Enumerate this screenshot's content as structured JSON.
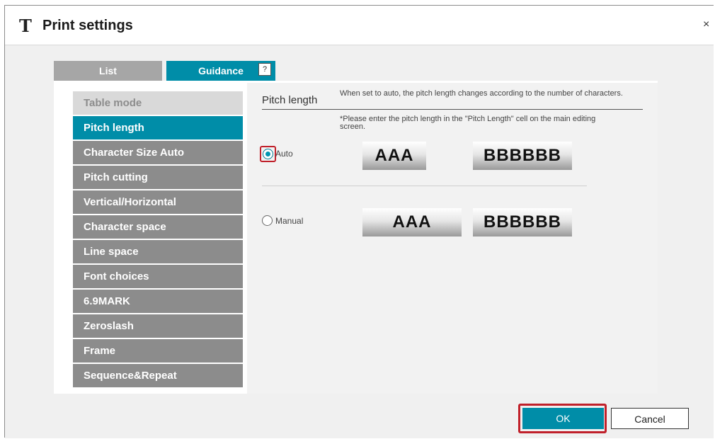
{
  "window": {
    "title": "Print settings",
    "app_icon_glyph": "T",
    "close_glyph": "×"
  },
  "tabs": [
    {
      "label": "List",
      "active": false
    },
    {
      "label": "Guidance",
      "active": true
    }
  ],
  "help_glyph": "?",
  "sidebar": {
    "items": [
      {
        "label": "Table mode"
      },
      {
        "label": "Pitch length"
      },
      {
        "label": "Character Size Auto"
      },
      {
        "label": "Pitch cutting"
      },
      {
        "label": "Vertical/Horizontal"
      },
      {
        "label": "Character space"
      },
      {
        "label": "Line space"
      },
      {
        "label": "Font choices"
      },
      {
        "label": "6.9MARK"
      },
      {
        "label": "Zeroslash"
      },
      {
        "label": "Frame"
      },
      {
        "label": "Sequence&Repeat"
      }
    ],
    "active_index": 1
  },
  "content": {
    "title": "Pitch length",
    "description": "When set to auto, the pitch length changes according to the number of characters.",
    "note": "*Please enter the pitch length in the \"Pitch Length\" cell on the main editing screen.",
    "options": [
      {
        "label": "Auto",
        "checked": true,
        "samples": [
          "AAA",
          "BBBBBB"
        ]
      },
      {
        "label": "Manual",
        "checked": false,
        "samples": [
          "AAA",
          "BBBBBB"
        ]
      }
    ]
  },
  "footer": {
    "ok_label": "OK",
    "cancel_label": "Cancel"
  },
  "colors": {
    "accent": "#008da8",
    "sidebar_inactive": "#8c8c8c",
    "sidebar_header": "#d9d9d9",
    "highlight": "#c0202a"
  }
}
